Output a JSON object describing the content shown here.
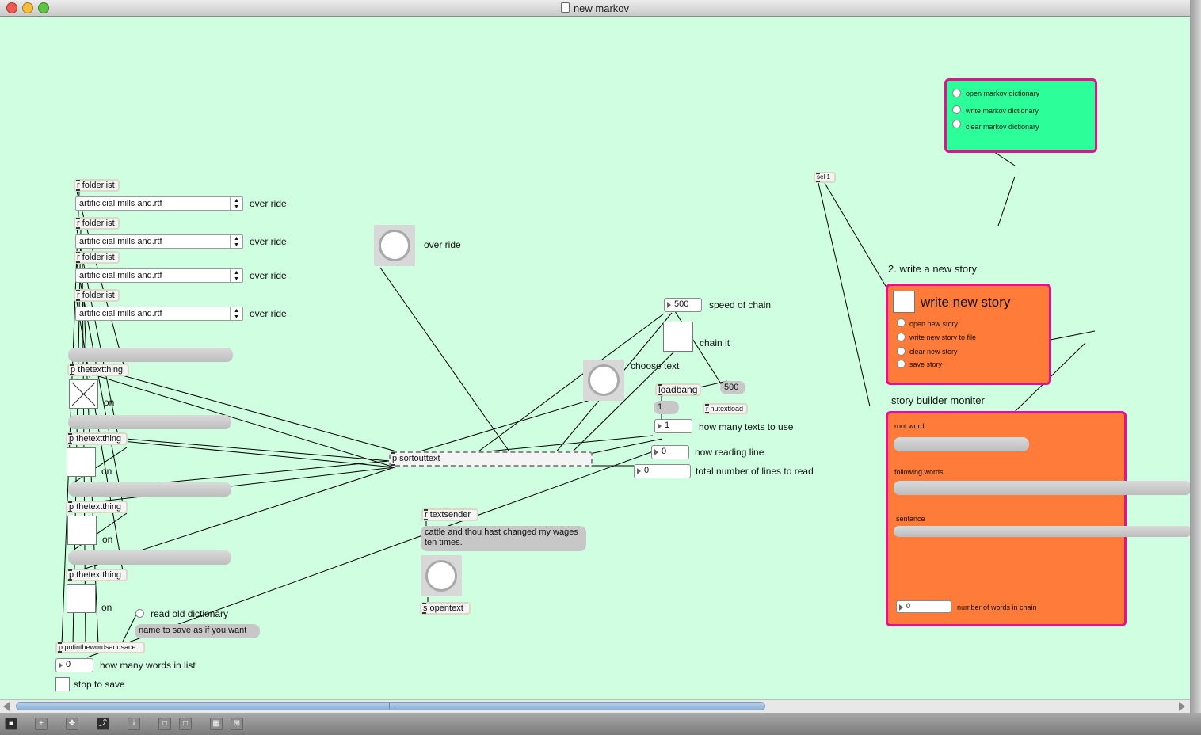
{
  "window": {
    "title": "new markov"
  },
  "folderlist_label": "r folderlist",
  "menu_value": "artificicial mills and.rtf",
  "over_ride": "over ride",
  "textthing_label": "p thetextthing",
  "on_label": "on",
  "bang_over_ride_label": "over ride",
  "sortouttext_label": "p sortouttext",
  "textsender_label": "r textsender",
  "text_message": "cattle and thou hast changed my wages ten times.",
  "opentext_label": "s opentext",
  "speed": {
    "value": "500",
    "label": "speed of chain"
  },
  "chain_it": "chain it",
  "choose_text": "choose text",
  "loadbang": "loadbang",
  "msg_500": "500",
  "msg_1": "1",
  "nutextload": "r nutextload",
  "texts_to_use": {
    "value": "1",
    "label": "how many texts to use"
  },
  "now_reading": {
    "value": "0",
    "label": "now reading line"
  },
  "total_lines": {
    "value": "0",
    "label": "total number of lines to read"
  },
  "read_old_dictionary": "read old dictionary",
  "name_to_save": "name to save as if you want",
  "putinthewords": "p putinthewordsandsace",
  "words_in_list": {
    "value": "0",
    "label": "how many words in list"
  },
  "stop_to_save": "stop to save",
  "sel_label": "sel 1",
  "dictionary_panel": {
    "items": [
      "open markov dictionary",
      "write markov dictionary",
      "clear markov dictionary"
    ],
    "color": "#2cff9a"
  },
  "story_section_heading": "2. write a new story",
  "story_panel": {
    "title": "write new story",
    "items": [
      "open new story",
      "write new story to file",
      "clear new story",
      "save story"
    ],
    "color": "#ff7b3a"
  },
  "monitor_heading": "story builder moniter",
  "monitor_panel": {
    "root_word": "root word",
    "following_words": "following words",
    "sentance": "sentance",
    "chain_count": {
      "value": "0",
      "label": "number of words in chain"
    }
  },
  "colors": {
    "canvas": "#cfffe0",
    "panel_border": "#e0128c"
  }
}
